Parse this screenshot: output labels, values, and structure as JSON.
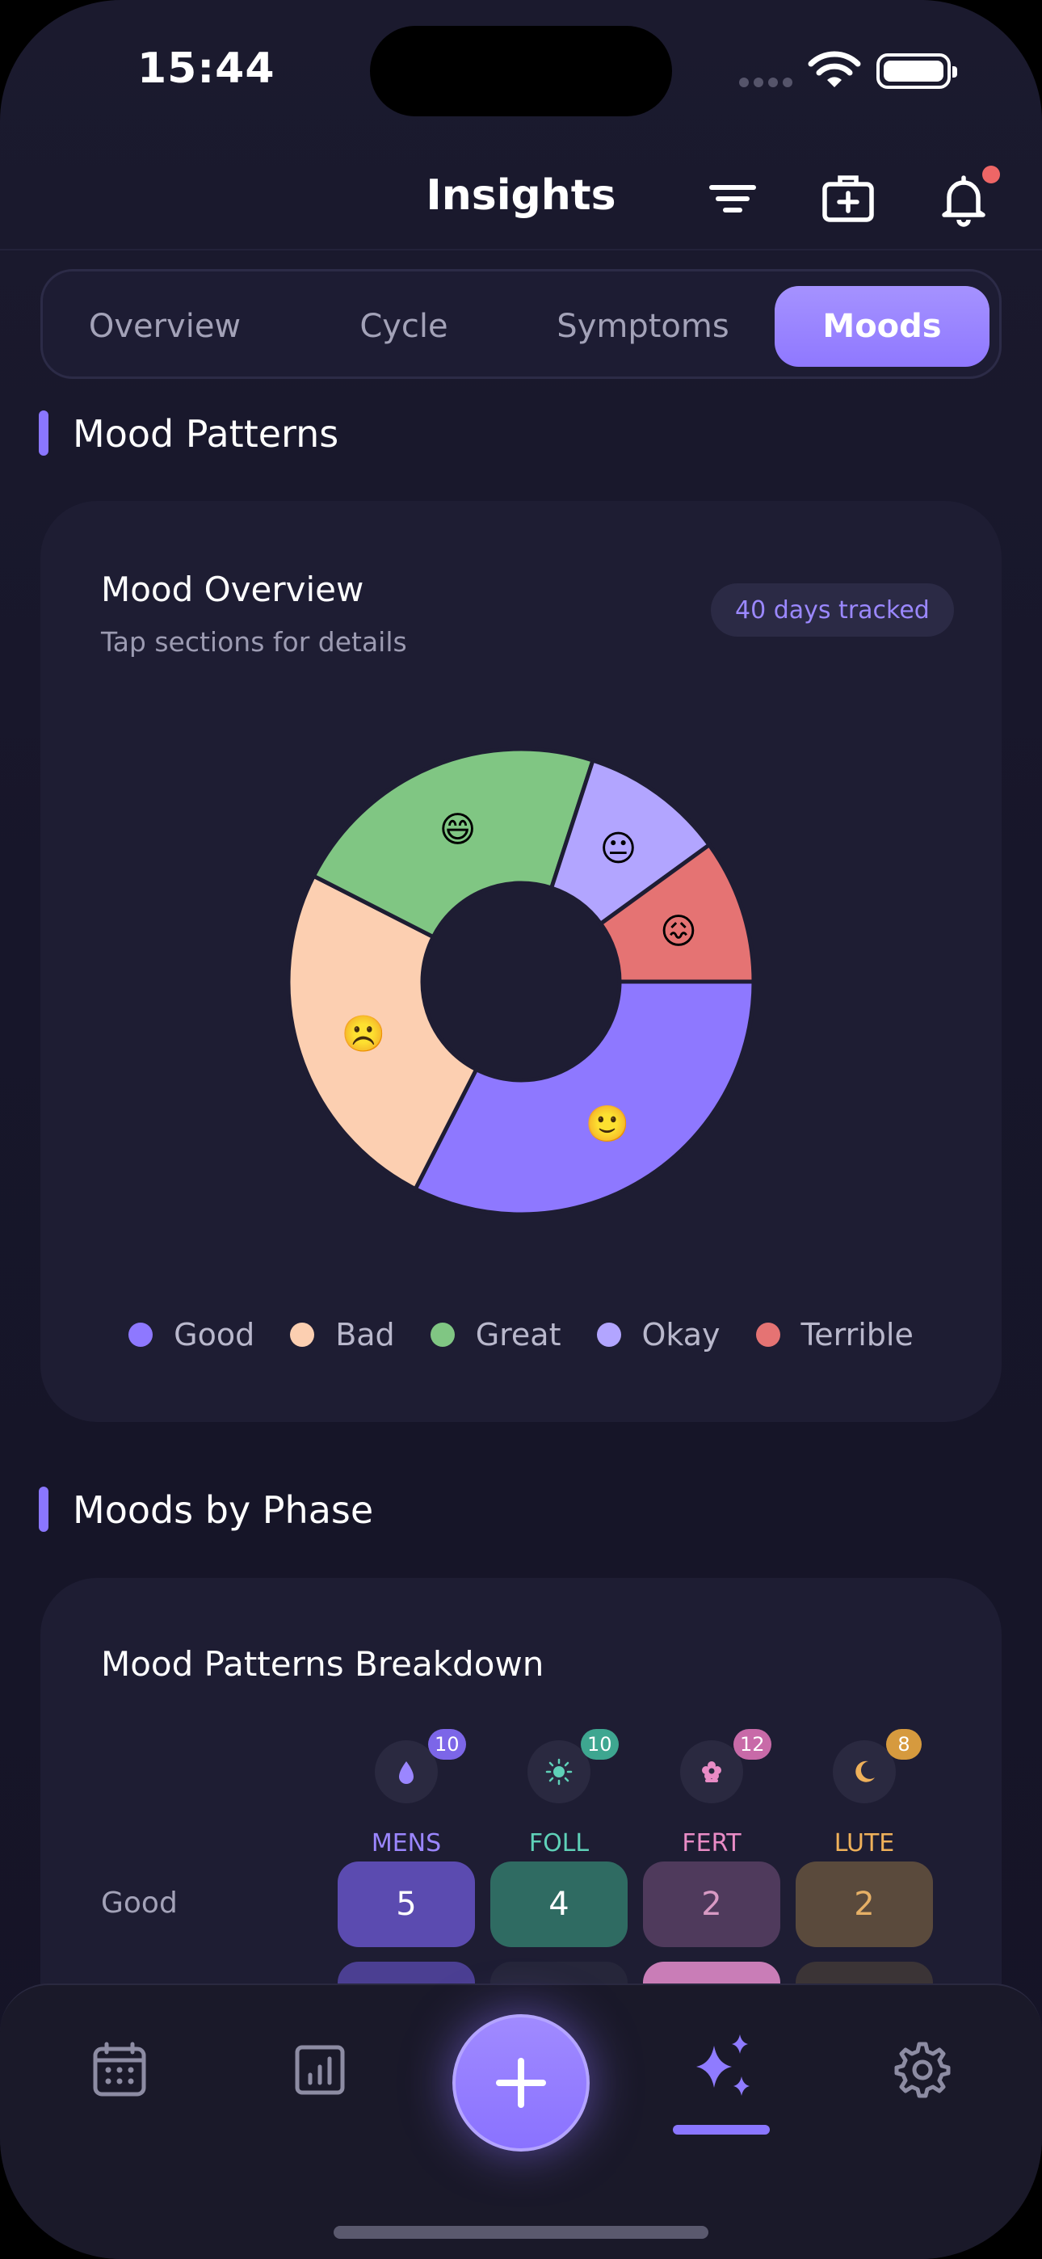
{
  "status_bar": {
    "time": "15:44"
  },
  "header": {
    "title": "Insights",
    "icons": [
      "filter-icon",
      "medical-kit-icon",
      "bell-icon"
    ],
    "has_notification": true
  },
  "tabs": [
    {
      "label": "Overview",
      "active": false
    },
    {
      "label": "Cycle",
      "active": false
    },
    {
      "label": "Symptoms",
      "active": false
    },
    {
      "label": "Moods",
      "active": true
    }
  ],
  "mood_patterns": {
    "section_title": "Mood Patterns",
    "card": {
      "title": "Mood Overview",
      "subtitle": "Tap sections for details",
      "badge": "40 days tracked"
    }
  },
  "chart_data": {
    "type": "pie",
    "donut": true,
    "categories": [
      "Good",
      "Bad",
      "Great",
      "Okay",
      "Terrible"
    ],
    "values": [
      13,
      10,
      9,
      4,
      4
    ],
    "colors": [
      "#8e78ff",
      "#fccfb1",
      "#80c683",
      "#b2a5ff",
      "#e57373"
    ],
    "emojis": [
      "🙂",
      "☹️",
      "😄",
      "😐",
      "😖"
    ],
    "legend": "bottom"
  },
  "moods_by_phase": {
    "section_title": "Moods by Phase",
    "card_title": "Mood Patterns Breakdown",
    "phases": [
      {
        "label": "MENS",
        "count": "10",
        "color": "#9b86ff",
        "badge_color": "#7c66e8",
        "icon": "drop-icon"
      },
      {
        "label": "FOLL",
        "count": "10",
        "color": "#5fd1b8",
        "badge_color": "#3ea690",
        "icon": "sun-icon"
      },
      {
        "label": "FERT",
        "count": "12",
        "color": "#e98cc6",
        "badge_color": "#c86aa8",
        "icon": "flower-icon"
      },
      {
        "label": "LUTE",
        "count": "8",
        "color": "#efb15a",
        "badge_color": "#d69a3e",
        "icon": "moon-icon"
      }
    ],
    "rows": [
      {
        "label": "Good",
        "values": [
          "5",
          "4",
          "2",
          "2"
        ]
      }
    ]
  },
  "bottom_nav": {
    "items": [
      "calendar-icon",
      "chart-icon",
      "add-icon",
      "sparkles-icon",
      "gear-icon"
    ],
    "active": "sparkles-icon"
  }
}
